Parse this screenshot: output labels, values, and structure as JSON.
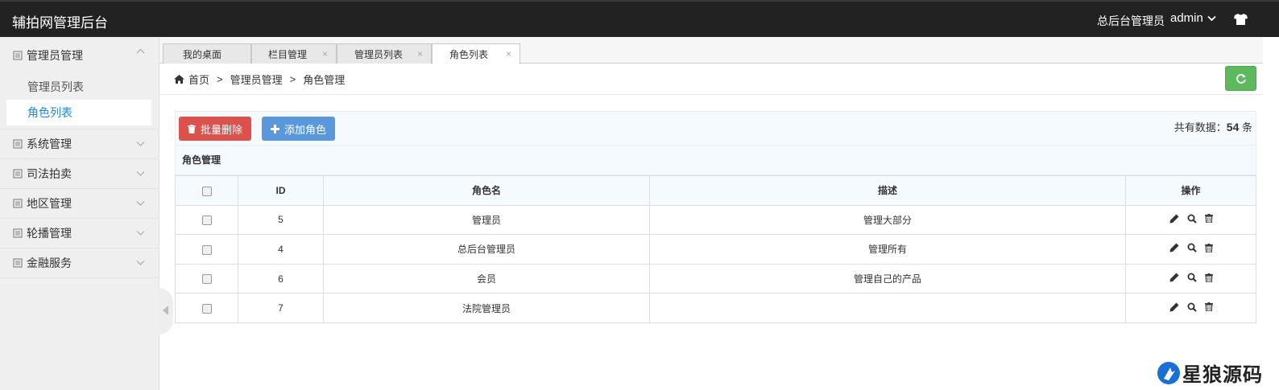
{
  "header": {
    "brand": "辅拍网管理后台",
    "role": "总后台管理员",
    "username": "admin"
  },
  "sidebar": {
    "groups": [
      {
        "label": "管理员管理",
        "open": true,
        "items": [
          {
            "label": "管理员列表",
            "active": false
          },
          {
            "label": "角色列表",
            "active": true
          }
        ]
      },
      {
        "label": "系统管理"
      },
      {
        "label": "司法拍卖"
      },
      {
        "label": "地区管理"
      },
      {
        "label": "轮播管理"
      },
      {
        "label": "金融服务"
      }
    ]
  },
  "tabs": [
    {
      "label": "我的桌面",
      "closable": false
    },
    {
      "label": "栏目管理",
      "closable": true
    },
    {
      "label": "管理员列表",
      "closable": true
    },
    {
      "label": "角色列表",
      "closable": true,
      "active": true
    }
  ],
  "tab_close_glyph": "×",
  "breadcrumb": {
    "home": "首页",
    "sep": ">",
    "level1": "管理员管理",
    "level2": "角色管理"
  },
  "toolbar": {
    "batch_delete": "批量删除",
    "add_role": "添加角色",
    "count_prefix": "共有数据：",
    "count_value": "54",
    "count_suffix": " 条"
  },
  "table": {
    "caption": "角色管理",
    "columns": {
      "id": "ID",
      "name": "角色名",
      "desc": "描述",
      "ops": "操作"
    },
    "rows": [
      {
        "id": "5",
        "name": "管理员",
        "desc": "管理大部分"
      },
      {
        "id": "4",
        "name": "总后台管理员",
        "desc": "管理所有"
      },
      {
        "id": "6",
        "name": "会员",
        "desc": "管理自己的产品"
      },
      {
        "id": "7",
        "name": "法院管理员",
        "desc": ""
      }
    ]
  },
  "watermark": "星狼源码",
  "colors": {
    "topbar": "#222222",
    "danger": "#dd514c",
    "primary": "#5a98de",
    "success": "#5eb95e",
    "active_link": "#148cf1"
  },
  "icons": [
    "shirt-icon",
    "chevron-down-icon",
    "document-icon",
    "home-icon",
    "refresh-icon",
    "trash-icon",
    "plus-icon",
    "edit-icon",
    "search-icon",
    "caret-left-icon"
  ]
}
